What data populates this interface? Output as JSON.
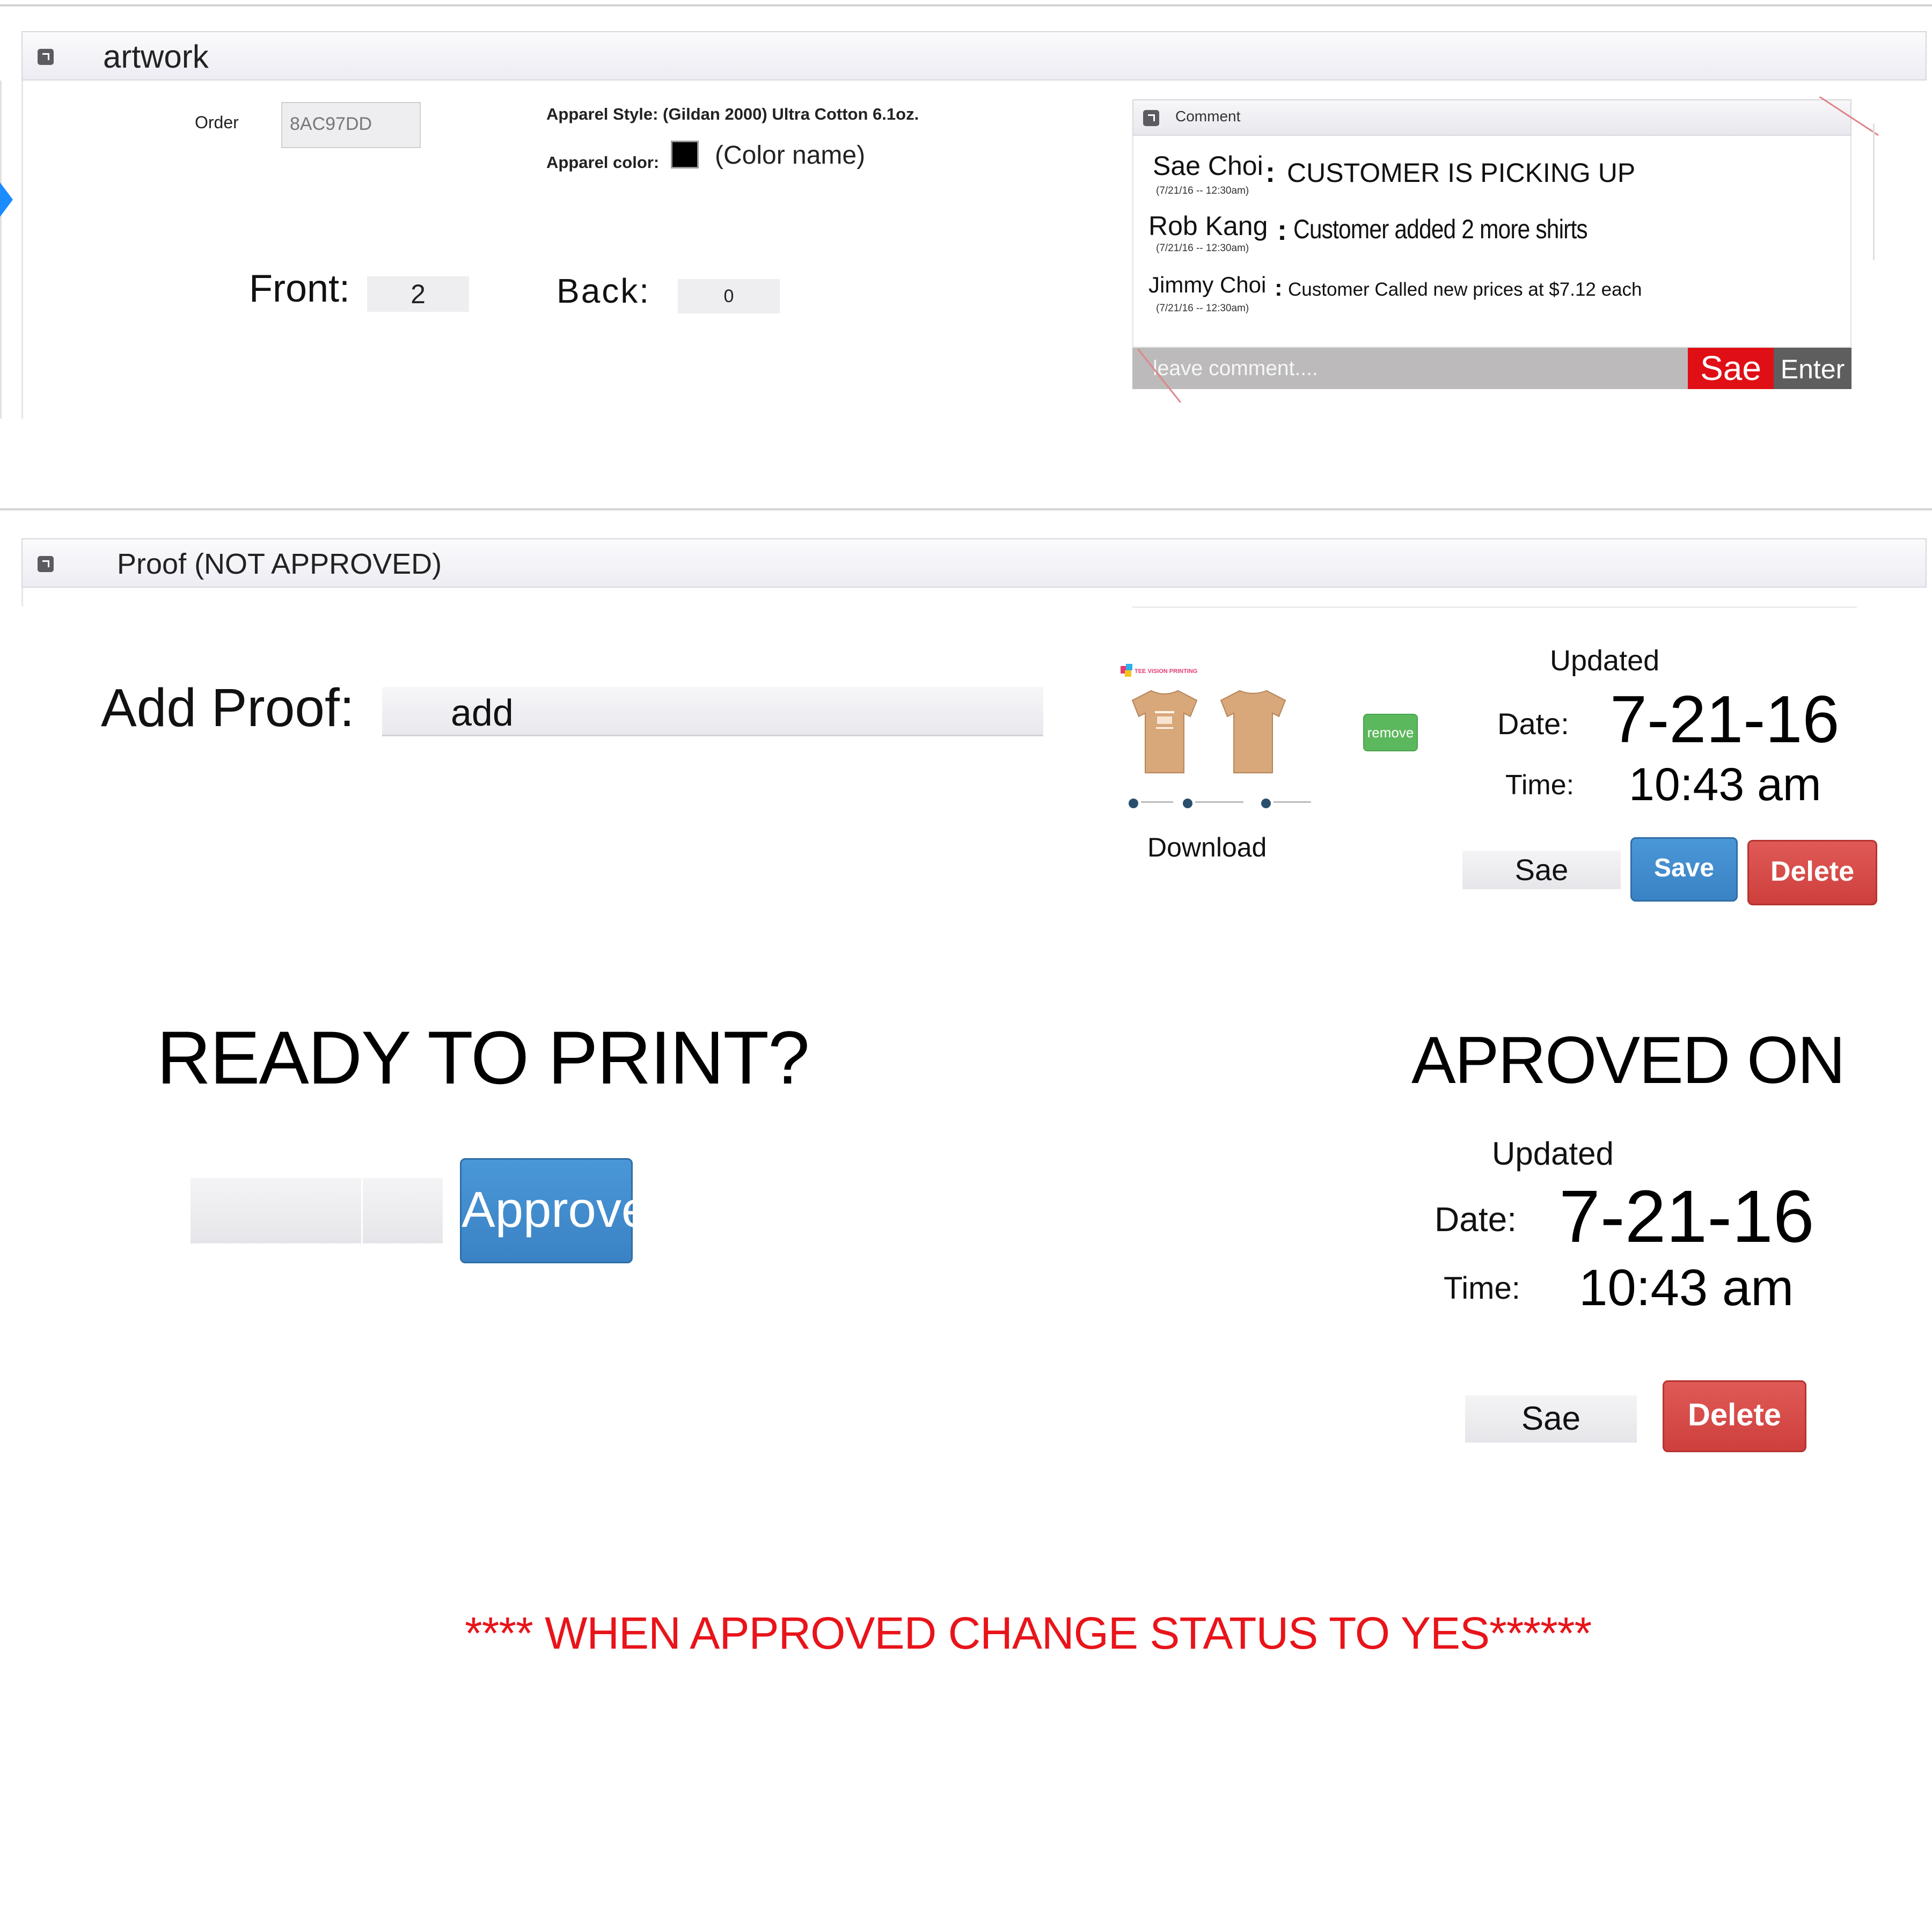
{
  "artwork_panel": {
    "title": "artwork",
    "order_label": "Order",
    "order_value": "8AC97DD",
    "apparel_style": "Apparel Style: (Gildan 2000) Ultra Cotton 6.1oz.",
    "apparel_color_label": "Apparel color:",
    "apparel_color_name": "(Color name)",
    "apparel_color_swatch": "#000000",
    "front_label": "Front:",
    "front_value": "2",
    "back_label": "Back:",
    "back_value": "0"
  },
  "comments": {
    "title": "Comment",
    "items": [
      {
        "author": "Sae Choi",
        "time": "(7/21/16 -- 12:30am)",
        "text": "CUSTOMER IS PICKING UP"
      },
      {
        "author": "Rob Kang",
        "time": "(7/21/16 -- 12:30am)",
        "text": "Customer  added 2 more shirts"
      },
      {
        "author": "Jimmy Choi",
        "time": "(7/21/16 -- 12:30am)",
        "text": "Customer Called new prices at $7.12 each"
      }
    ],
    "input_placeholder": "leave comment....",
    "user_button": "Sae",
    "enter_button": "Enter"
  },
  "proof_panel": {
    "title": "Proof (NOT APPROVED)",
    "add_proof_label": "Add Proof:",
    "add_value": "add",
    "thumbnail_brand": "TEE VISION PRINTING",
    "download_label": "Download",
    "remove_button": "remove",
    "updated_label": "Updated",
    "date_label": "Date:",
    "date_value": "7-21-16",
    "time_label": "Time:",
    "time_value": "10:43 am",
    "user_value": "Sae",
    "save_button": "Save",
    "delete_button": "Delete"
  },
  "approval": {
    "ready_heading": "READY TO PRINT?",
    "approve_button": "Approve",
    "approved_heading": "APROVED ON",
    "updated_label": "Updated",
    "date_label": "Date:",
    "date_value": "7-21-16",
    "time_label": "Time:",
    "time_value": "10:43 am",
    "user_value": "Sae",
    "delete_button": "Delete"
  },
  "note": "**** WHEN APPROVED CHANGE STATUS TO YES******",
  "colors": {
    "accent_blue": "#3a82c3",
    "danger_red": "#cd3f3c",
    "success_green": "#5cb85c",
    "note_red": "#e8141a",
    "comment_user_red": "#e00f16",
    "comment_enter_gray": "#5e5e5e",
    "tshirt": "#d8a77a"
  }
}
